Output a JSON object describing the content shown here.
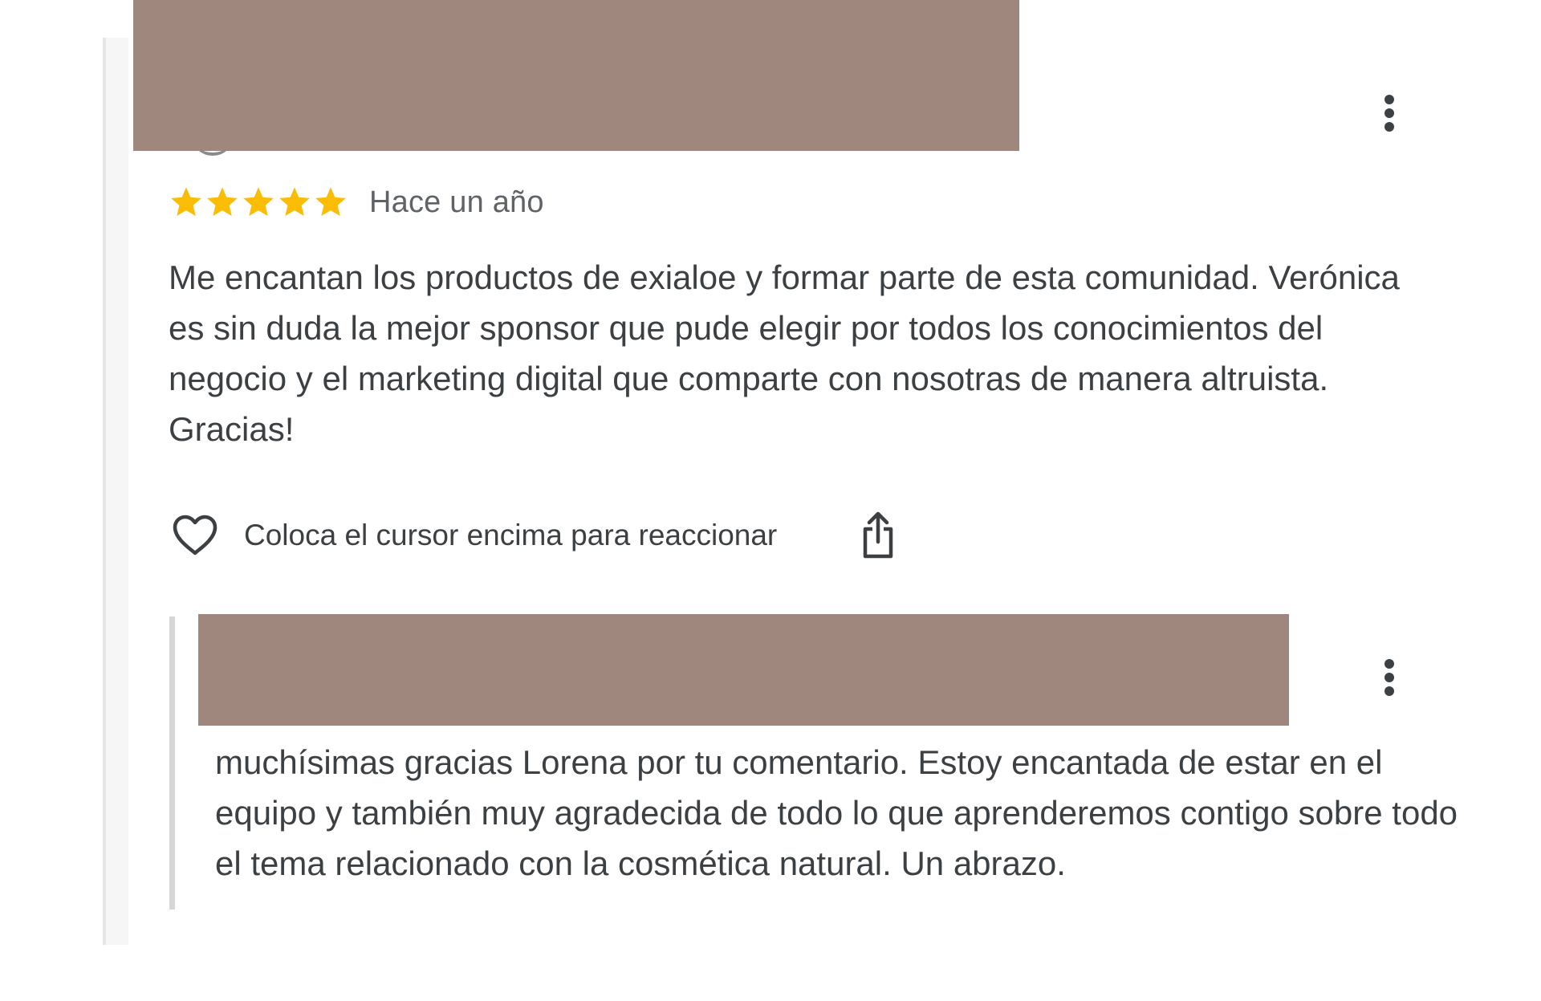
{
  "review": {
    "rating": 5,
    "rating_max": 5,
    "star_color": "#fbbc04",
    "date": "Hace un año",
    "text": "Me encantan los productos de exialoe y formar parte de esta comunidad. Verónica es sin duda la mejor sponsor que pude elegir por todos los conocimientos del negocio y el marketing digital que comparte con nosotras de manera altruista. Gracias!",
    "more_icon": "more-vertical-icon"
  },
  "actions": {
    "react_icon": "heart-icon",
    "react_hint": "Coloca el cursor encima para reaccionar",
    "share_icon": "share-icon"
  },
  "reply": {
    "text": "muchísimas gracias Lorena por tu comentario. Estoy encantada de estar en el equipo y también muy agradecida de todo lo que aprenderemos contigo sobre todo el tema relacionado con la cosmética natural. Un abrazo.",
    "more_icon": "more-vertical-icon"
  },
  "colors": {
    "redaction": "#a0877d",
    "text": "#3c4043",
    "muted_text": "#5f6368",
    "thread_line": "#e6e6e6",
    "reply_bar": "#d6d6d6"
  }
}
